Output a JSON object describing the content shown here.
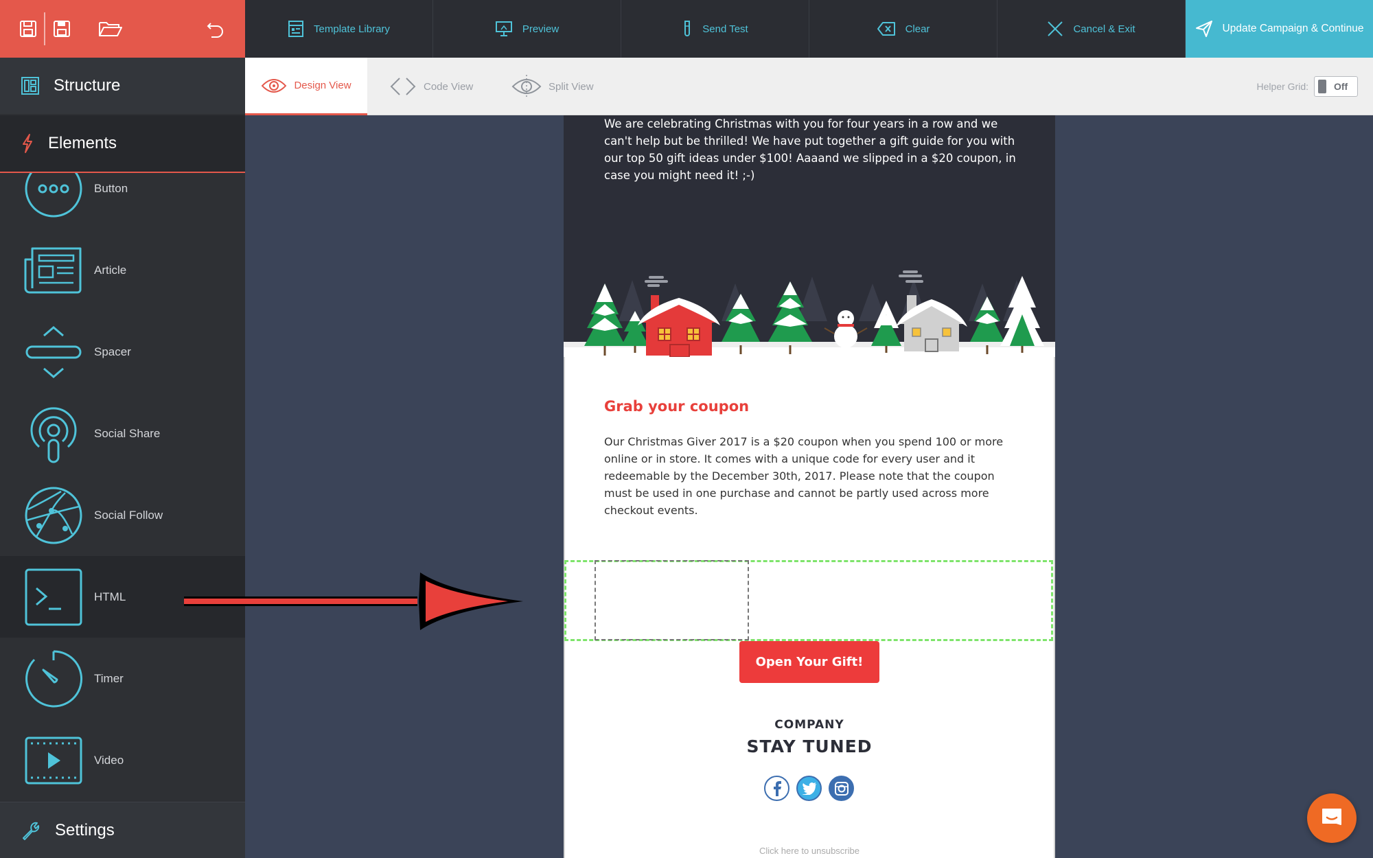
{
  "toolbar": {
    "template_library": "Template Library",
    "preview": "Preview",
    "send_test": "Send Test",
    "clear": "Clear",
    "cancel_exit": "Cancel & Exit",
    "update_campaign": "Update Campaign & Continue"
  },
  "sidebar": {
    "structure": "Structure",
    "elements": "Elements",
    "settings": "Settings",
    "items": [
      {
        "label": "Button",
        "icon": "button-icon"
      },
      {
        "label": "Article",
        "icon": "article-icon"
      },
      {
        "label": "Spacer",
        "icon": "spacer-icon"
      },
      {
        "label": "Social Share",
        "icon": "social-share-icon"
      },
      {
        "label": "Social Follow",
        "icon": "social-follow-icon"
      },
      {
        "label": "HTML",
        "icon": "html-icon"
      },
      {
        "label": "Timer",
        "icon": "timer-icon"
      },
      {
        "label": "Video",
        "icon": "video-icon"
      }
    ]
  },
  "views": {
    "design": "Design View",
    "code": "Code View",
    "split": "Split View",
    "helper_grid_label": "Helper Grid:",
    "helper_grid_value": "Off"
  },
  "email": {
    "hero_text": "We are celebrating Christmas with you for four years in a row and we can't help but be thrilled! We have put together a gift guide for you with our top 50 gift ideas under $100! Aaaand we slipped in a $20 coupon, in case you might need it! ;-)",
    "coupon_title": "Grab your coupon",
    "coupon_body": "Our Christmas Giver 2017 is a $20 coupon when you spend 100 or more online or in store. It comes with a unique code for every user and it redeemable by the December 30th, 2017. Please note that the coupon must be used in one purchase and cannot be partly used across more checkout events.",
    "button_label": "Open Your Gift!",
    "company": "COMPANY",
    "stay_tuned": "STAY TUNED",
    "unsubscribe": "Click here to unsubscribe",
    "social": [
      "facebook-icon",
      "twitter-icon",
      "instagram-icon"
    ]
  },
  "colors": {
    "accent": "#e4584b",
    "teal": "#4fc3d9",
    "update_bg": "#46b9d0",
    "sidebar_bg": "#2e3034",
    "canvas_bg": "#3b4458",
    "coupon_red": "#e8403b",
    "dropzone_green": "#7ee46b"
  }
}
